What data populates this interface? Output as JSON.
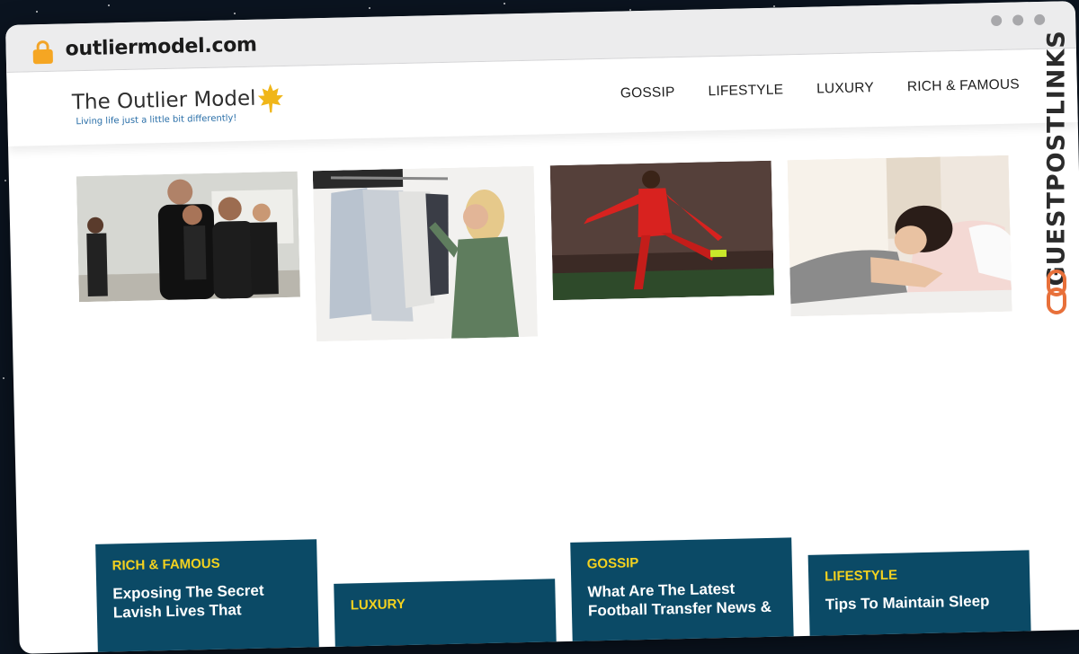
{
  "browser": {
    "url": "outliermodel.com",
    "lock_icon": "lock-icon",
    "window_controls": [
      "dot",
      "dot",
      "dot"
    ]
  },
  "site": {
    "logo_title": "The Outlier Model",
    "logo_icon": "maple-leaf-icon",
    "tagline": "Living life just a little bit differently!",
    "nav": [
      "GOSSIP",
      "LIFESTYLE",
      "LUXURY",
      "RICH & FAMOUS"
    ]
  },
  "images": [
    {
      "subject": "group-training-photo"
    },
    {
      "subject": "clothes-rack-shopping-photo"
    },
    {
      "subject": "football-player-photo"
    },
    {
      "subject": "woman-sleeping-photo"
    }
  ],
  "cards": [
    {
      "category": "RICH & FAMOUS",
      "title": "Exposing The Secret\nLavish Lives That"
    },
    {
      "category": "LUXURY",
      "title": ""
    },
    {
      "category": "GOSSIP",
      "title": "What Are The Latest\nFootball Transfer News &"
    },
    {
      "category": "LIFESTYLE",
      "title": "Tips To Maintain Sleep"
    }
  ],
  "watermark": {
    "text": "GUESTPOSTLINKS",
    "icon": "chain-link-icon"
  },
  "colors": {
    "card_bg": "#0b4a66",
    "category_text": "#f3d21f",
    "lock": "#f5a623",
    "chain": "#e8703a"
  }
}
